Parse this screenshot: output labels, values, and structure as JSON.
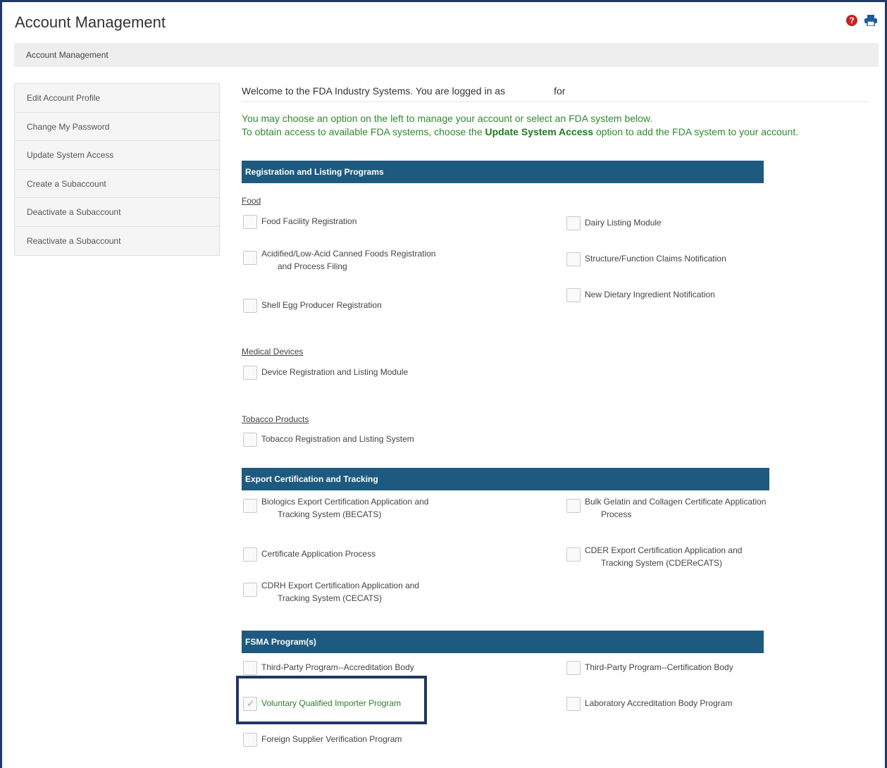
{
  "header": {
    "title": "Account Management",
    "breadcrumb": "Account Management",
    "help_icon": "help-icon",
    "print_icon": "print-icon",
    "accent_color": "#1e5a7f"
  },
  "sidebar": {
    "items": [
      {
        "label": "Edit Account Profile"
      },
      {
        "label": "Change My Password"
      },
      {
        "label": "Update System Access"
      },
      {
        "label": "Create a Subaccount"
      },
      {
        "label": "Deactivate a Subaccount"
      },
      {
        "label": "Reactivate a Subaccount"
      }
    ]
  },
  "main": {
    "welcome_prefix": "Welcome to the FDA Industry Systems. You are logged in as",
    "welcome_for": "for",
    "intro_line1": "You may choose an option on the left to manage your account or select an FDA system below.",
    "intro_line2_prefix": "To obtain access to available FDA systems, choose the",
    "intro_line2_bold": "Update System Access",
    "intro_line2_suffix": "option to add the FDA system to your account.",
    "sections": {
      "registration": {
        "title": "Registration and Listing Programs",
        "food_label": "Food",
        "food": {
          "ffr": "Food Facility Registration",
          "acidified_1": "Acidified/Low-Acid Canned Foods Registration",
          "acidified_2": "and Process Filing",
          "shell_egg": "Shell Egg Producer Registration",
          "dairy": "Dairy Listing Module",
          "structure": "Structure/Function Claims Notification",
          "ndi": "New Dietary Ingredient Notification"
        },
        "devices_label": "Medical Devices",
        "device_registration": "Device Registration and Listing Module",
        "tobacco_label": "Tobacco Products",
        "tobacco_registration": "Tobacco Registration and Listing System"
      },
      "export": {
        "title": "Export Certification and Tracking",
        "becats_1": "Biologics Export Certification Application and",
        "becats_2": "Tracking System (BECATS)",
        "cap": "Certificate Application Process",
        "cecats_1": "CDRH Export Certification Application and",
        "cecats_2": "Tracking System (CECATS)",
        "gelatin_1": "Bulk Gelatin and Collagen Certificate Application",
        "gelatin_2": "Process",
        "cderecats_1": "CDER Export Certification Application and",
        "cderecats_2": "Tracking System (CDEReCATS)"
      },
      "fsma": {
        "title": "FSMA Program(s)",
        "tpp_ab": "Third-Party Program--Accreditation Body",
        "vqip": "Voluntary Qualified Importer Program",
        "fsvp": "Foreign Supplier Verification Program",
        "tpp_cb": "Third-Party Program--Certification Body",
        "lab": "Laboratory Accreditation Body Program",
        "vqip_checked": true
      }
    }
  }
}
